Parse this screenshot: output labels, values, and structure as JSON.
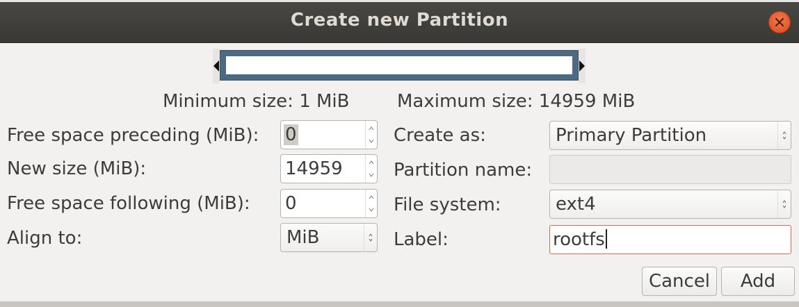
{
  "window": {
    "title": "Create new Partition"
  },
  "size_info": {
    "minimum": "Minimum size: 1 MiB",
    "maximum": "Maximum size: 14959 MiB"
  },
  "left_fields": {
    "free_preceding_label": "Free space preceding (MiB):",
    "free_preceding_value": "0",
    "new_size_label": "New size (MiB):",
    "new_size_value": "14959",
    "free_following_label": "Free space following (MiB):",
    "free_following_value": "0",
    "align_label": "Align to:",
    "align_value": "MiB"
  },
  "right_fields": {
    "create_as_label": "Create as:",
    "create_as_value": "Primary Partition",
    "partition_name_label": "Partition name:",
    "partition_name_value": "",
    "file_system_label": "File system:",
    "file_system_value": "ext4",
    "label_label": "Label:",
    "label_value": "rootfs"
  },
  "buttons": {
    "cancel": "Cancel",
    "add": "Add"
  },
  "colors": {
    "accent": "#e9693f",
    "close_button": "#e0531f",
    "partition_frame": "#4e6a82"
  }
}
